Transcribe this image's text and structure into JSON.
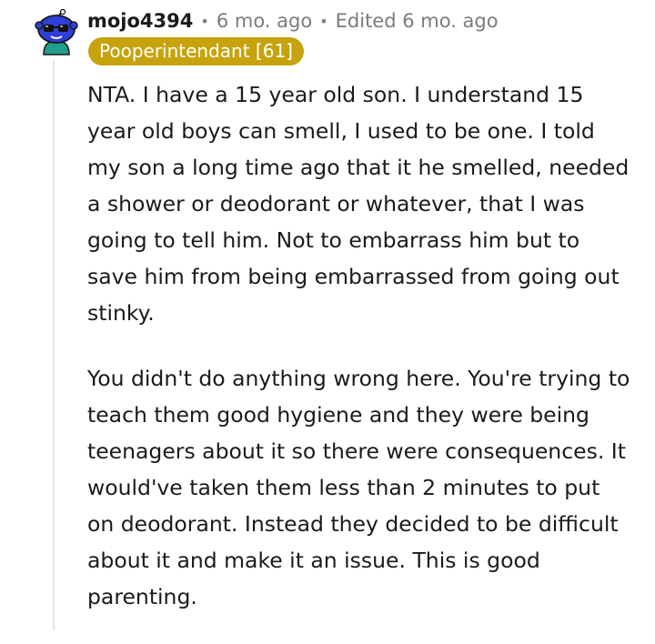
{
  "comment": {
    "avatar_icon": "snoo-avatar-sunglasses-icon",
    "username": "mojo4394",
    "age": "6 mo. ago",
    "edited": "Edited 6 mo. ago",
    "flair": "Pooperintendant [61]",
    "colors": {
      "flair_background": "#c6a30c",
      "meta_text": "#7c7c7c",
      "avatar_background": "#2f3fd8"
    },
    "paragraphs": [
      "NTA. I have a 15 year old son. I understand 15 year old boys can smell, I used to be one. I told my son a long time ago that it he smelled, needed a shower or deodorant or whatever, that I was going to tell him. Not to embarrass him but to save him from being embarrassed from going out stinky.",
      "You didn't do anything wrong here. You're trying to teach them good hygiene and they were being teenagers about it so there were consequences. It would've taken them less than 2 minutes to put on deodorant. Instead they decided to be difficult about it and make it an issue. This is good parenting."
    ]
  }
}
